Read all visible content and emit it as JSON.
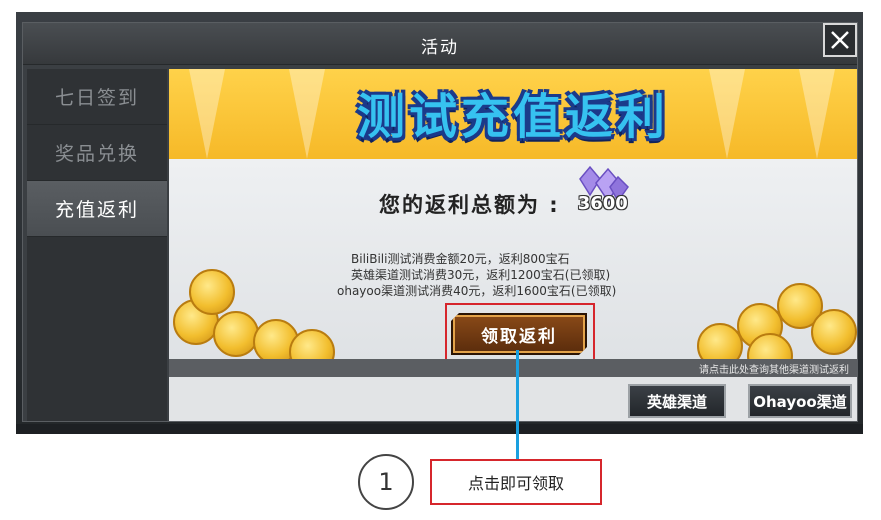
{
  "window": {
    "title": "活动"
  },
  "sidebar": {
    "items": [
      {
        "label": "七日签到"
      },
      {
        "label": "奖品兑换"
      },
      {
        "label": "充值返利"
      }
    ],
    "active_index": 2
  },
  "banner": {
    "title": "测试充值返利"
  },
  "rebate": {
    "total_label": "您的返利总额为 :",
    "total_value": "3600",
    "records": [
      "BiliBili测试消费金额20元，返利800宝石",
      "英雄渠道测试消费30元，返利1200宝石(已领取)",
      "ohayoo渠道测试消费40元，返利1600宝石(已领取)"
    ]
  },
  "claim_button": {
    "label": "领取返利"
  },
  "query_link": "请点击此处查询其他渠道测试返利",
  "channel_buttons": {
    "hero": "英雄渠道",
    "ohayoo": "Ohayoo渠道"
  },
  "annotation": {
    "step": "1",
    "note": "点击即可领取"
  },
  "colors": {
    "accent_red": "#d6262c",
    "connector_blue": "#1aa0e0",
    "banner_yellow": "#f6b928"
  }
}
